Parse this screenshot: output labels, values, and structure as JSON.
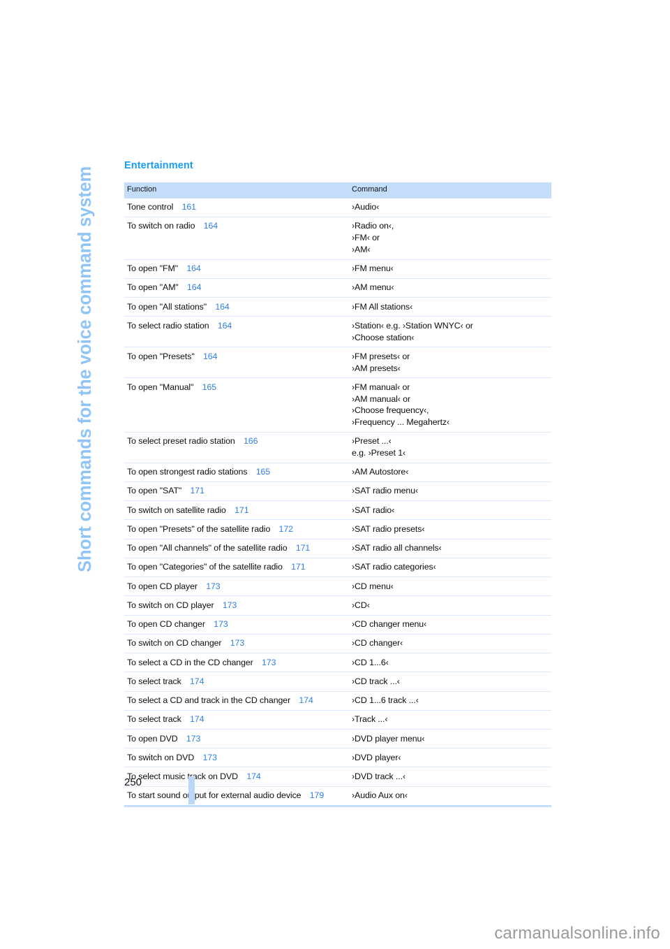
{
  "sidebar": {
    "title": "Short commands for the voice command system"
  },
  "section": {
    "heading": "Entertainment"
  },
  "table": {
    "headers": {
      "function": "Function",
      "command": "Command"
    },
    "rows": [
      {
        "function": "Tone control",
        "page": "161",
        "commands": [
          "›Audio‹"
        ]
      },
      {
        "function": "To switch on radio",
        "page": "164",
        "commands": [
          "›Radio on‹,",
          "›FM‹ or",
          "›AM‹"
        ]
      },
      {
        "function": "To open \"FM\"",
        "page": "164",
        "commands": [
          "›FM menu‹"
        ]
      },
      {
        "function": "To open \"AM\"",
        "page": "164",
        "commands": [
          "›AM menu‹"
        ]
      },
      {
        "function": "To open \"All stations\"",
        "page": "164",
        "commands": [
          "›FM All stations‹"
        ]
      },
      {
        "function": "To select radio station",
        "page": "164",
        "commands": [
          "›Station‹ e.g. ›Station WNYC‹ or",
          "›Choose station‹"
        ]
      },
      {
        "function": "To open \"Presets\"",
        "page": "164",
        "commands": [
          "›FM presets‹ or",
          "›AM presets‹"
        ]
      },
      {
        "function": "To open \"Manual\"",
        "page": "165",
        "commands": [
          "›FM manual‹ or",
          "›AM manual‹ or",
          "›Choose frequency‹,",
          "›Frequency ... Megahertz‹"
        ]
      },
      {
        "function": "To select preset radio station",
        "page": "166",
        "commands": [
          "›Preset ...‹",
          "e.g. ›Preset 1‹"
        ]
      },
      {
        "function": "To open strongest radio stations",
        "page": "165",
        "commands": [
          "›AM Autostore‹"
        ]
      },
      {
        "function": "To open \"SAT\"",
        "page": "171",
        "commands": [
          "›SAT radio menu‹"
        ]
      },
      {
        "function": "To switch on satellite radio",
        "page": "171",
        "commands": [
          "›SAT radio‹"
        ]
      },
      {
        "function": "To open \"Presets\" of the satellite radio",
        "page": "172",
        "commands": [
          "›SAT radio presets‹"
        ]
      },
      {
        "function": "To open \"All channels\" of the satellite radio",
        "page": "171",
        "commands": [
          "›SAT radio all channels‹"
        ]
      },
      {
        "function": "To open \"Categories\" of the satellite radio",
        "page": "171",
        "commands": [
          "›SAT radio categories‹"
        ]
      },
      {
        "function": "To open CD player",
        "page": "173",
        "commands": [
          "›CD menu‹"
        ]
      },
      {
        "function": "To switch on CD player",
        "page": "173",
        "commands": [
          "›CD‹"
        ]
      },
      {
        "function": "To open CD changer",
        "page": "173",
        "commands": [
          "›CD changer menu‹"
        ]
      },
      {
        "function": "To switch on CD changer",
        "page": "173",
        "commands": [
          "›CD changer‹"
        ]
      },
      {
        "function": "To select a CD in the CD changer",
        "page": "173",
        "commands": [
          "›CD 1...6‹"
        ]
      },
      {
        "function": "To select track",
        "page": "174",
        "commands": [
          "›CD track ...‹"
        ]
      },
      {
        "function": "To select a CD and track in the CD changer",
        "page": "174",
        "commands": [
          "›CD 1...6 track ...‹"
        ]
      },
      {
        "function": "To select track",
        "page": "174",
        "commands": [
          "›Track ...‹"
        ]
      },
      {
        "function": "To open DVD",
        "page": "173",
        "commands": [
          "›DVD player menu‹"
        ]
      },
      {
        "function": "To switch on DVD",
        "page": "173",
        "commands": [
          "›DVD player‹"
        ]
      },
      {
        "function": "To select music track on DVD",
        "page": "174",
        "commands": [
          "›DVD track ...‹"
        ]
      },
      {
        "function": "To start sound output for external audio device",
        "page": "179",
        "commands": [
          "›Audio Aux on‹"
        ]
      }
    ]
  },
  "footer": {
    "page_number": "250"
  },
  "watermark": {
    "text": "carmanualsonline.info"
  },
  "colors": {
    "accent_blue": "#1a9ef4",
    "sidebar_blue": "#8fc4f4",
    "header_bg": "#c3ddfa",
    "page_ref_blue": "#2e7fe0",
    "row_divider": "#d9e9fb"
  }
}
